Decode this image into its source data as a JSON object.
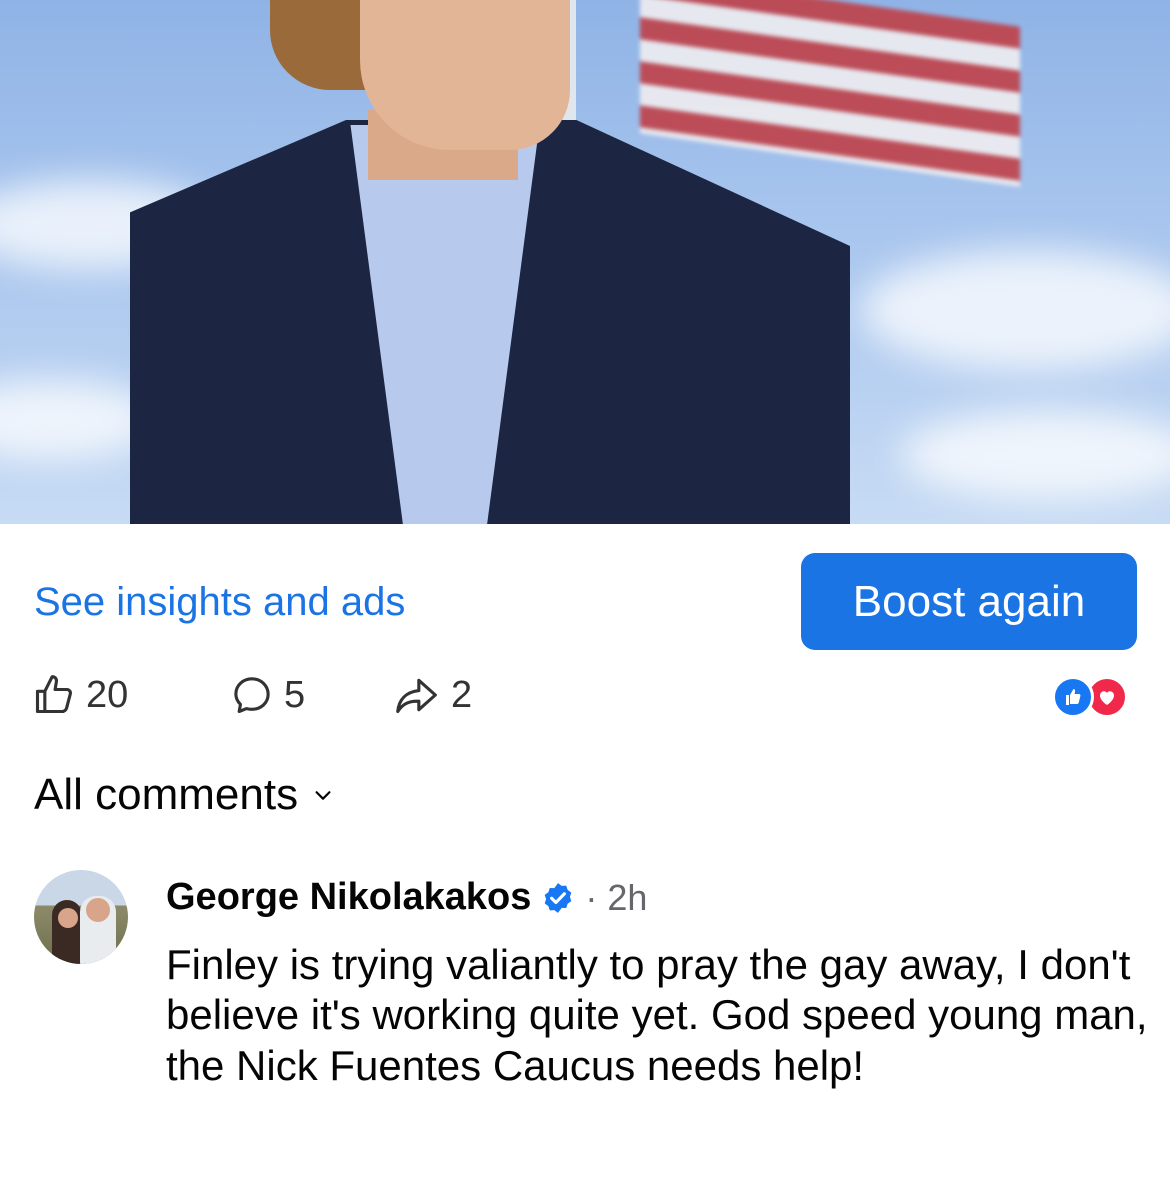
{
  "post": {
    "insights_link": "See insights and ads",
    "boost_button": "Boost again",
    "stats": {
      "likes": "20",
      "comments": "5",
      "shares": "2"
    },
    "reactions": [
      "like-icon",
      "love-icon"
    ]
  },
  "comments_section": {
    "filter_label": "All comments",
    "comment": {
      "author": "George Nikolakakos",
      "verified": true,
      "separator": "·",
      "time": "2h",
      "text": "Finley is trying valiantly to pray the gay away, I don't believe it's working quite yet. God speed young man, the Nick Fuentes Caucus needs help!"
    }
  },
  "colors": {
    "accent": "#1b74e4",
    "like_reaction": "#1877f2",
    "love_reaction": "#f02849",
    "secondary_text": "#65676b"
  }
}
